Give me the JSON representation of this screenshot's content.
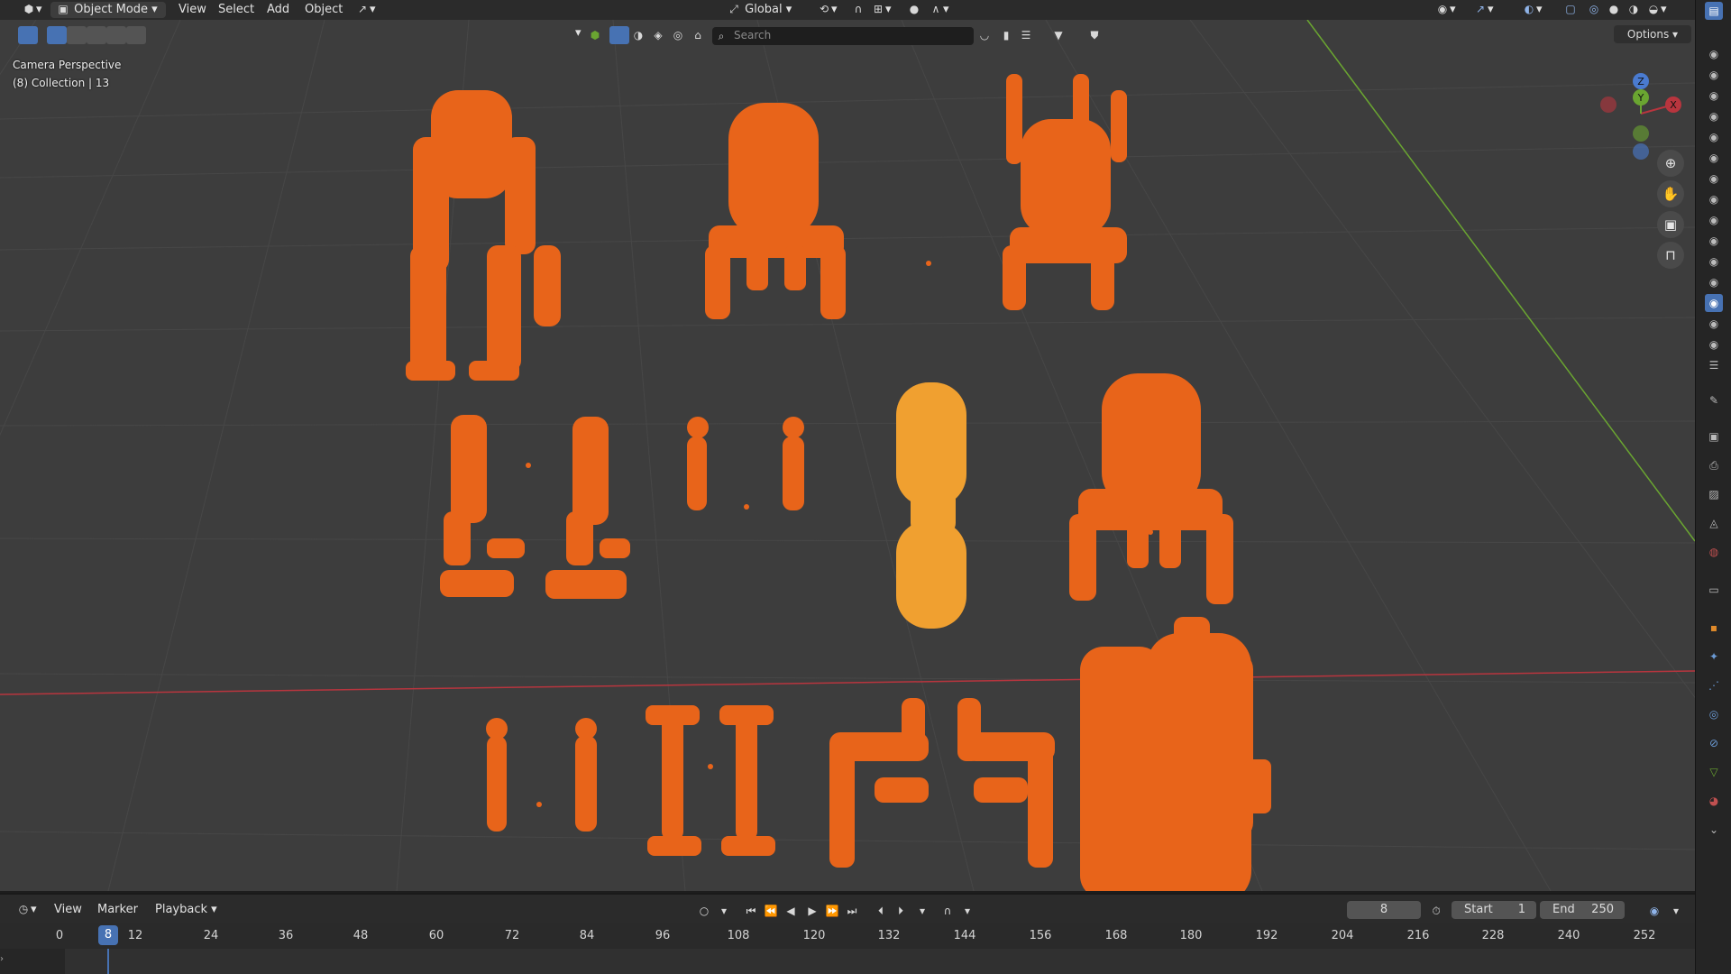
{
  "header": {
    "mode": "Object Mode",
    "menus": [
      "View",
      "Select",
      "Add",
      "Object"
    ],
    "orientation": "Global",
    "search_placeholder": "Search",
    "options_label": "Options"
  },
  "viewport": {
    "camera_label": "Camera Perspective",
    "collection_label": "(8) Collection | 13"
  },
  "gizmo": {
    "x": "X",
    "y": "Y",
    "z": "Z"
  },
  "timeline": {
    "menus": [
      "View",
      "Marker",
      "Playback"
    ],
    "current_frame": "8",
    "start_label": "Start",
    "start_value": "1",
    "end_label": "End",
    "end_value": "250",
    "ruler": [
      "0",
      "12",
      "24",
      "36",
      "48",
      "60",
      "72",
      "84",
      "96",
      "108",
      "120",
      "132",
      "144",
      "156",
      "168",
      "180",
      "192",
      "204",
      "216",
      "228",
      "240",
      "252"
    ],
    "playhead_label": "8"
  },
  "colors": {
    "selected": "#e8641a",
    "active": "#f0a030",
    "x_axis": "#b8353e",
    "y_axis": "#6aa531",
    "accent": "#4772b3"
  }
}
